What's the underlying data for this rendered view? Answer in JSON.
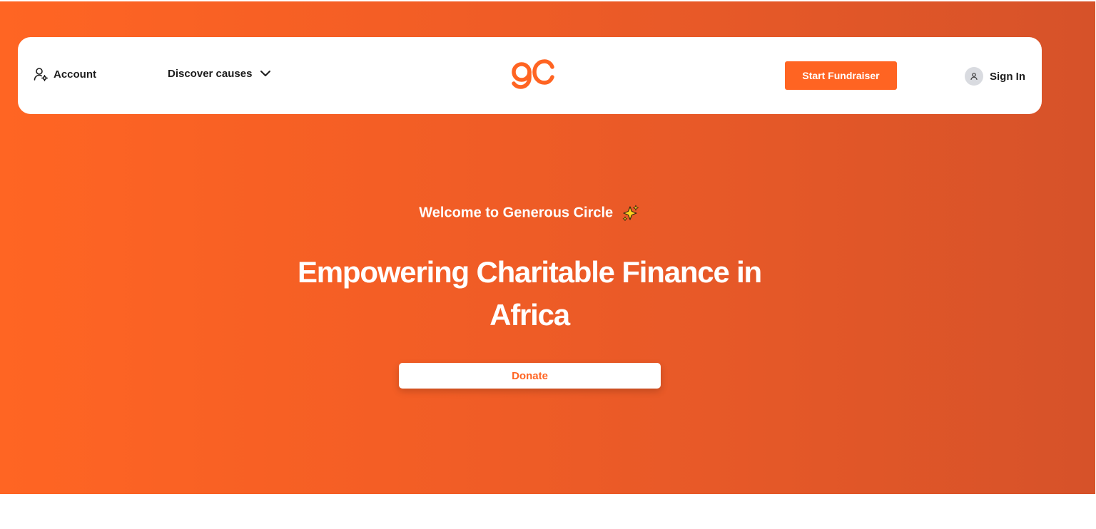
{
  "nav": {
    "account_label": "Account",
    "discover_label": "Discover causes",
    "start_fundraiser_label": "Start Fundraiser",
    "signin_label": "Sign In"
  },
  "hero": {
    "welcome_text": "Welcome to Generous Circle",
    "headline": "Empowering Charitable Finance in Africa",
    "donate_label": "Donate"
  },
  "icons": {
    "account": "user-gear-icon",
    "discover": "chevron-down-icon",
    "logo": "gc-logo",
    "signin": "user-avatar-icon",
    "sparkle": "sparkles-icon"
  },
  "colors": {
    "brand_orange": "#ff6422",
    "hero_gradient_start": "#ff6523",
    "hero_gradient_end": "#d65229",
    "text_dark": "#1c1c1c",
    "white": "#ffffff"
  }
}
